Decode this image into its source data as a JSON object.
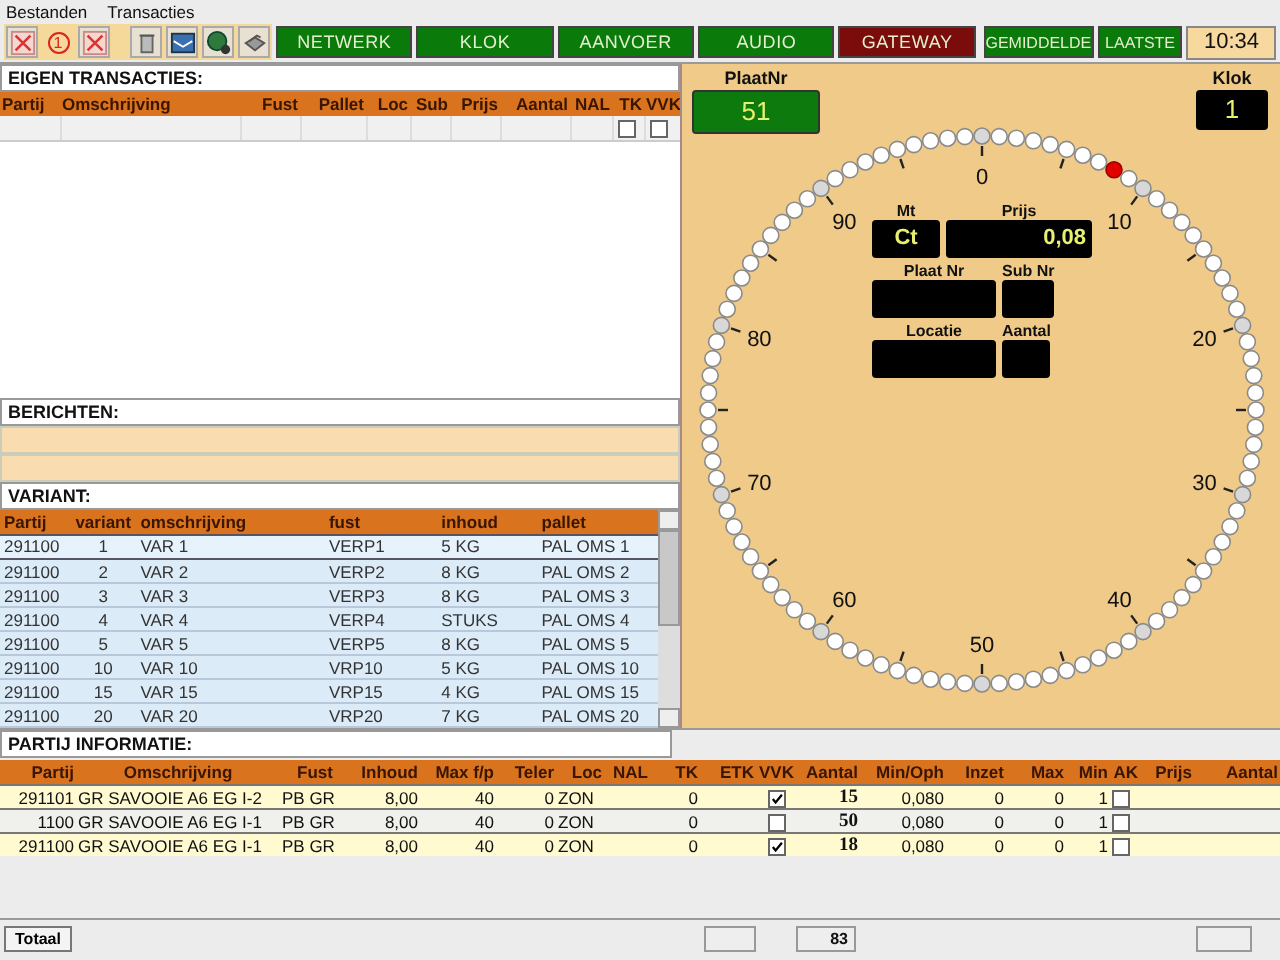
{
  "menu": [
    "Bestanden",
    "Transacties"
  ],
  "toolbar": {
    "badge": "1",
    "nav_buttons": [
      {
        "label": "NETWERK",
        "color": "#0a7a0a"
      },
      {
        "label": "KLOK",
        "color": "#0a7a0a"
      },
      {
        "label": "AANVOER",
        "color": "#0a7a0a"
      },
      {
        "label": "AUDIO",
        "color": "#0a7a0a"
      },
      {
        "label": "GATEWAY",
        "color": "#7a0c0c"
      }
    ],
    "view_buttons": [
      {
        "label": "GEMIDDELDE",
        "color": "#0a7a0a"
      },
      {
        "label": "LAATSTE",
        "color": "#0a7a0a"
      }
    ],
    "time": "10:34"
  },
  "eigen_transacties": {
    "title": "EIGEN TRANSACTIES:",
    "columns": [
      "Partij",
      "Omschrijving",
      "Fust",
      "Pallet",
      "Loc",
      "Sub",
      "Prijs",
      "Aantal",
      "NAL",
      "TK",
      "VVK"
    ],
    "rows": [
      {
        "tk": false,
        "vvk": false
      }
    ]
  },
  "berichten": {
    "title": "BERICHTEN:"
  },
  "variant": {
    "title": "VARIANT:",
    "columns": [
      "Partij",
      "variant",
      "omschrijving",
      "fust",
      "inhoud",
      "pallet"
    ],
    "rows": [
      {
        "cells": [
          "291100",
          "1",
          "VAR 1",
          "VERP1",
          "5 KG",
          "PAL OMS 1"
        ],
        "selected": true
      },
      {
        "cells": [
          "291100",
          "2",
          "VAR 2",
          "VERP2",
          "8 KG",
          "PAL OMS 2"
        ],
        "selected": false
      },
      {
        "cells": [
          "291100",
          "3",
          "VAR 3",
          "VERP3",
          "8 KG",
          "PAL OMS 3"
        ],
        "selected": false
      },
      {
        "cells": [
          "291100",
          "4",
          "VAR 4",
          "VERP4",
          "STUKS",
          "PAL OMS 4"
        ],
        "selected": false
      },
      {
        "cells": [
          "291100",
          "5",
          "VAR 5",
          "VERP5",
          "8 KG",
          "PAL OMS 5"
        ],
        "selected": false
      },
      {
        "cells": [
          "291100",
          "10",
          "VAR 10",
          "VRP10",
          "5 KG",
          "PAL OMS 10"
        ],
        "selected": false
      },
      {
        "cells": [
          "291100",
          "15",
          "VAR 15",
          "VRP15",
          "4 KG",
          "PAL OMS 15"
        ],
        "selected": false
      },
      {
        "cells": [
          "291100",
          "20",
          "VAR 20",
          "VRP20",
          "7 KG",
          "PAL OMS 20"
        ],
        "selected": false
      }
    ]
  },
  "clock": {
    "plaatnr_label": "PlaatNr",
    "plaatnr": "51",
    "klok_label": "Klok",
    "klok": "1",
    "dial_labels": [
      "0",
      "10",
      "20",
      "30",
      "40",
      "50",
      "60",
      "70",
      "80",
      "90"
    ],
    "dial_dots": [
      {
        "selected": false
      },
      {
        "selected": false
      },
      {
        "selected": false
      },
      {
        "selected": false
      },
      {
        "selected": false
      },
      {
        "selected": false
      },
      {
        "selected": false
      },
      {
        "selected": false
      },
      {
        "selected": true
      },
      {
        "selected": false
      },
      {
        "selected": false
      },
      {
        "selected": false
      },
      {
        "selected": false
      },
      {
        "selected": false
      },
      {
        "selected": false
      },
      {
        "selected": false
      },
      {
        "selected": false
      },
      {
        "selected": false
      },
      {
        "selected": false
      },
      {
        "selected": false
      },
      {
        "selected": false
      },
      {
        "selected": false
      },
      {
        "selected": false
      },
      {
        "selected": false
      },
      {
        "selected": false
      },
      {
        "selected": false
      },
      {
        "selected": false
      },
      {
        "selected": false
      },
      {
        "selected": false
      },
      {
        "selected": false
      },
      {
        "selected": false
      },
      {
        "selected": false
      },
      {
        "selected": false
      },
      {
        "selected": false
      },
      {
        "selected": false
      },
      {
        "selected": false
      },
      {
        "selected": false
      },
      {
        "selected": false
      },
      {
        "selected": false
      },
      {
        "selected": false
      },
      {
        "selected": false
      },
      {
        "selected": false
      },
      {
        "selected": false
      },
      {
        "selected": false
      },
      {
        "selected": false
      },
      {
        "selected": false
      },
      {
        "selected": false
      },
      {
        "selected": false
      },
      {
        "selected": false
      },
      {
        "selected": false
      },
      {
        "selected": false
      },
      {
        "selected": false
      },
      {
        "selected": false
      },
      {
        "selected": false
      },
      {
        "selected": false
      },
      {
        "selected": false
      },
      {
        "selected": false
      },
      {
        "selected": false
      },
      {
        "selected": false
      },
      {
        "selected": false
      },
      {
        "selected": false
      },
      {
        "selected": false
      },
      {
        "selected": false
      },
      {
        "selected": false
      },
      {
        "selected": false
      },
      {
        "selected": false
      },
      {
        "selected": false
      },
      {
        "selected": false
      },
      {
        "selected": false
      },
      {
        "selected": false
      },
      {
        "selected": false
      },
      {
        "selected": false
      },
      {
        "selected": false
      },
      {
        "selected": false
      },
      {
        "selected": false
      },
      {
        "selected": false
      },
      {
        "selected": false
      },
      {
        "selected": false
      },
      {
        "selected": false
      },
      {
        "selected": false
      },
      {
        "selected": false
      },
      {
        "selected": false
      },
      {
        "selected": false
      },
      {
        "selected": false
      },
      {
        "selected": false
      },
      {
        "selected": false
      },
      {
        "selected": false
      },
      {
        "selected": false
      },
      {
        "selected": false
      },
      {
        "selected": false
      },
      {
        "selected": false
      },
      {
        "selected": false
      },
      {
        "selected": false
      },
      {
        "selected": false
      },
      {
        "selected": false
      },
      {
        "selected": false
      },
      {
        "selected": false
      },
      {
        "selected": false
      },
      {
        "selected": false
      },
      {
        "selected": false
      }
    ],
    "fields": [
      {
        "label": "Mt",
        "value": "Ct"
      },
      {
        "label": "Prijs",
        "value": "0,08"
      },
      {
        "label": "Plaat Nr"
      },
      {
        "label": "Sub Nr"
      },
      {
        "label": "Locatie"
      },
      {
        "label": "Aantal"
      }
    ]
  },
  "partij_informatie": {
    "title": "PARTIJ INFORMATIE:",
    "columns": [
      "Partij",
      "Omschrijving",
      "Fust",
      "Inhoud",
      "Max f/p",
      "Teler",
      "Loc",
      "NAL",
      "TK",
      "ETK",
      "VVK",
      "Aantal",
      "Min/Oph",
      "Inzet",
      "Max",
      "Min",
      "AK",
      "Prijs",
      "Aantal"
    ],
    "rows": [
      {
        "partij": "291101",
        "omschrijving": "GR SAVOOIE A6 EG I-2",
        "fust": "PB GR",
        "inhoud": "8,00",
        "max_fp": "40",
        "teler": "0",
        "loc": "ZON",
        "tk": "0",
        "vvk": true,
        "aantal": "15",
        "min_oph": "0,080",
        "inzet": "0",
        "max": "0",
        "min": "1",
        "ak": false
      },
      {
        "partij": "1100",
        "omschrijving": "GR SAVOOIE A6 EG I-1",
        "fust": "PB GR",
        "inhoud": "8,00",
        "max_fp": "40",
        "teler": "0",
        "loc": "ZON",
        "tk": "0",
        "vvk": false,
        "aantal": "50",
        "min_oph": "0,080",
        "inzet": "0",
        "max": "0",
        "min": "1",
        "ak": false
      },
      {
        "partij": "291100",
        "omschrijving": "GR SAVOOIE A6 EG I-1",
        "fust": "PB GR",
        "inhoud": "8,00",
        "max_fp": "40",
        "teler": "0",
        "loc": "ZON",
        "tk": "0",
        "vvk": true,
        "aantal": "18",
        "min_oph": "0,080",
        "inzet": "0",
        "max": "0",
        "min": "1",
        "ak": false
      }
    ]
  },
  "status_bar": {
    "total_label": "Totaal",
    "total_aantal": "83"
  }
}
